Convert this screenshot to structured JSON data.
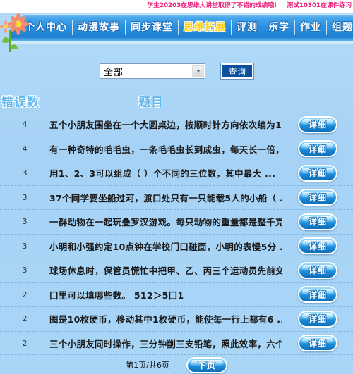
{
  "marquee": {
    "messages": [
      "学生20203在思维大讲堂取得了不错的成绩哦!",
      "测试10301在课件练习"
    ]
  },
  "nav": {
    "items": [
      {
        "label": "个人中心",
        "active": false
      },
      {
        "label": "动漫故事",
        "active": false
      },
      {
        "label": "同步课堂",
        "active": false
      },
      {
        "label": "思维拓展",
        "active": true
      },
      {
        "label": "评测",
        "active": false
      },
      {
        "label": "乐学",
        "active": false
      },
      {
        "label": "作业",
        "active": false
      },
      {
        "label": "组题",
        "active": false
      }
    ]
  },
  "search": {
    "select_value": "全部",
    "select_options": [
      "全部"
    ],
    "query_label": "查询"
  },
  "table": {
    "headers": {
      "errors": "错误数",
      "title": "题目"
    },
    "detail_label": "详细",
    "rows": [
      {
        "errors": "4",
        "title": "五个小朋友围坐在一个大圆桌边，按顺时针方向依次编为1 ..."
      },
      {
        "errors": "4",
        "title": "有一种奇特的毛毛虫，一条毛毛虫长到成虫，每天长一倍， ..."
      },
      {
        "errors": "3",
        "title": "用1、2、3可以组成（ ）个不同的三位数，其中最大 ..."
      },
      {
        "errors": "3",
        "title": "37个同学要坐船过河，渡口处只有一只能载5人的小船（ ..."
      },
      {
        "errors": "3",
        "title": "一群动物在一起玩叠罗汉游戏。每只动物的重量都是整千克 ..."
      },
      {
        "errors": "3",
        "title": "小明和小强约定10点钟在学校门口碰面，小明的表慢5分 ..."
      },
      {
        "errors": "3",
        "title": "球场休息时，保管员慌忙中把甲、乙、丙三个运动员先前交 ..."
      },
      {
        "errors": "2",
        "title": "囗里可以填哪些数。 512＞5囗1"
      },
      {
        "errors": "2",
        "title": "图是10枚硬币，移动其中1枚硬币，能使每一行上都有6 ..."
      },
      {
        "errors": "2",
        "title": "三个小朋友同时操作，三分钟削三支铅笔，照此效率，六个 ..."
      }
    ]
  },
  "footer": {
    "page_info": "第1页/共6页",
    "next_label": "下页"
  },
  "colors": {
    "page_background": "#a9d6f7",
    "nav_gradient_top": "#4aa8ec",
    "nav_gradient_bottom": "#1f7fd0",
    "active_tab_text": "#ffd015",
    "marquee_text": "#e8237a",
    "header_text": "#63b8ef",
    "query_button": "#0b4f9e"
  }
}
